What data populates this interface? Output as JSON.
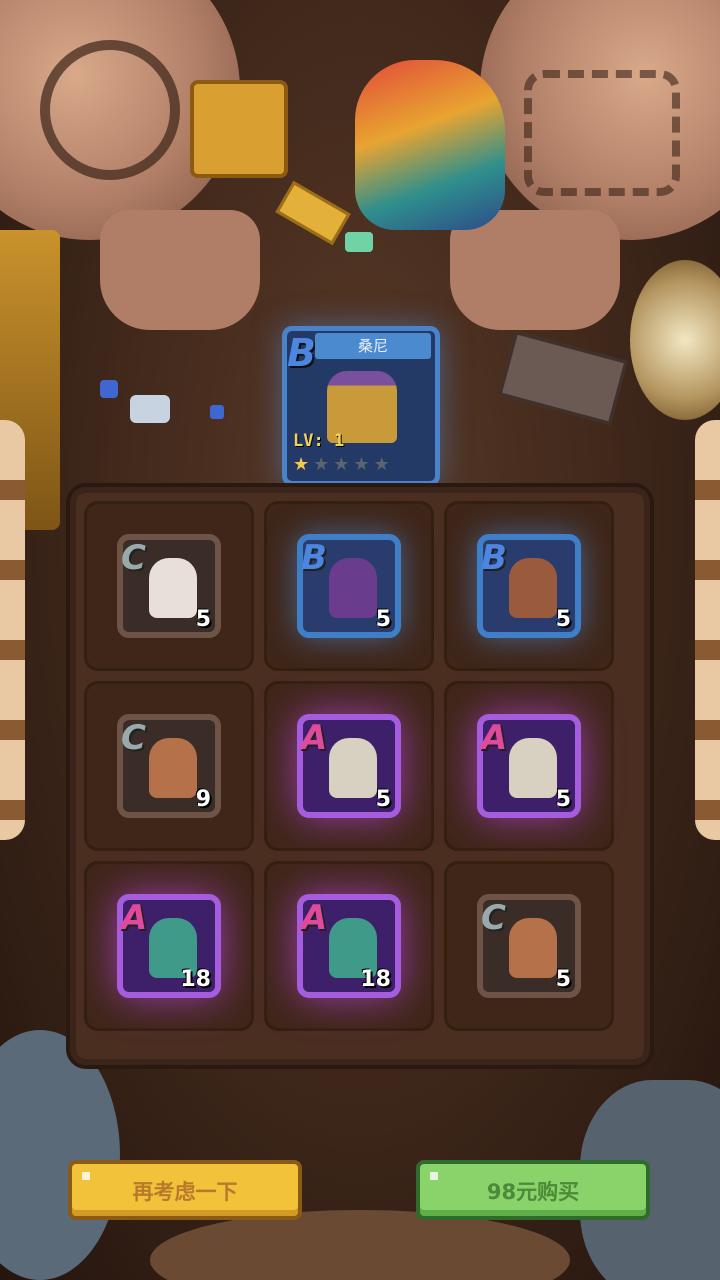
{
  "hero": {
    "name": "桑尼",
    "rank": "B",
    "level": "LV: 1",
    "stars_total": 5,
    "stars_filled": 1
  },
  "cards": [
    {
      "rank": "C",
      "count": "5",
      "figure_color": "#e8e0d8",
      "name": "white-haired-warrior"
    },
    {
      "rank": "B",
      "count": "5",
      "figure_color": "#6a3c8e",
      "name": "purple-shadow"
    },
    {
      "rank": "B",
      "count": "5",
      "figure_color": "#9a5a3e",
      "name": "brown-fighter"
    },
    {
      "rank": "C",
      "count": "9",
      "figure_color": "#b5714a",
      "name": "brown-hair-villager"
    },
    {
      "rank": "A",
      "count": "5",
      "figure_color": "#d8d0c0",
      "name": "white-beard-sage"
    },
    {
      "rank": "A",
      "count": "5",
      "figure_color": "#d8d0c0",
      "name": "white-beard-sage"
    },
    {
      "rank": "A",
      "count": "18",
      "figure_color": "#3f9a8a",
      "name": "green-alien"
    },
    {
      "rank": "A",
      "count": "18",
      "figure_color": "#3f9a8a",
      "name": "green-alien"
    },
    {
      "rank": "C",
      "count": "5",
      "figure_color": "#b5714a",
      "name": "brown-hair-villager"
    }
  ],
  "buttons": {
    "cancel_label": "再考虑一下",
    "buy_label": "98元购买"
  },
  "colors": {
    "rank_C": "#6e5446",
    "rank_B": "#3f7fc7",
    "rank_A": "#a55dde",
    "cancel_button": "#f2c23b",
    "buy_button": "#8ad26a"
  }
}
